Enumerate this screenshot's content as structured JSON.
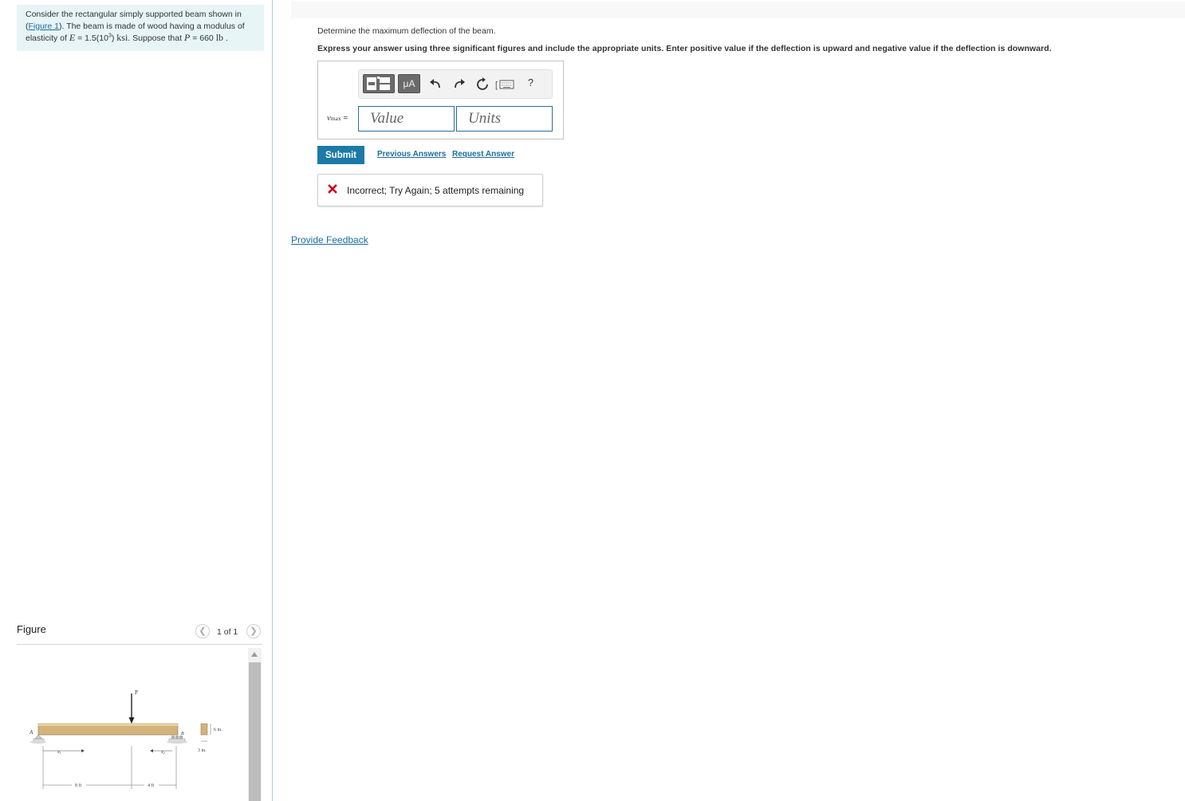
{
  "problem": {
    "line1": "Consider the rectangular simply supported beam shown in",
    "figure_link": "Figure 1",
    "line2_rest": ". The beam is made of wood having a modulus of",
    "line3_pre": "elasticity of ",
    "E_symbol": "E",
    "E_value": " = 1.5(10",
    "E_exp": "3",
    "E_close": ") ",
    "E_unit": "ksi",
    "mid": ". Suppose that ",
    "P_symbol": "P",
    "P_value": " = 660 ",
    "P_unit": "lb",
    "end": " ."
  },
  "figure": {
    "title": "Figure",
    "page_indicator": "1 of 1",
    "labels": {
      "P": "P",
      "A": "A",
      "B": "B",
      "x1": "x",
      "x1_sub": "1",
      "x2": "x",
      "x2_sub": "2",
      "span1": "8 ft",
      "span2": "4 ft",
      "depth": "6 in.",
      "width": "3 in."
    }
  },
  "question": {
    "prompt": "Determine the maximum deflection of the beam.",
    "instruction": "Express your answer using three significant figures and include the appropriate units. Enter positive value if the deflection is upward and negative value if the deflection is downward."
  },
  "toolbar": {
    "units_label": "μA",
    "help_label": "?"
  },
  "answer": {
    "var_symbol": "v",
    "var_sub": "max",
    "var_eq": " =",
    "value_placeholder": "Value",
    "units_placeholder": "Units"
  },
  "actions": {
    "submit": "Submit",
    "previous_answers": "Previous Answers",
    "request_answer": "Request Answer"
  },
  "feedback": {
    "message": "Incorrect; Try Again; 5 attempts remaining"
  },
  "footer": {
    "provide_feedback": "Provide Feedback"
  },
  "colors": {
    "accent": "#1b7aa7",
    "link": "#1c6c9c",
    "error": "#d0021b",
    "problem_bg": "#e7f5f6",
    "beam": "#d2b37a"
  }
}
